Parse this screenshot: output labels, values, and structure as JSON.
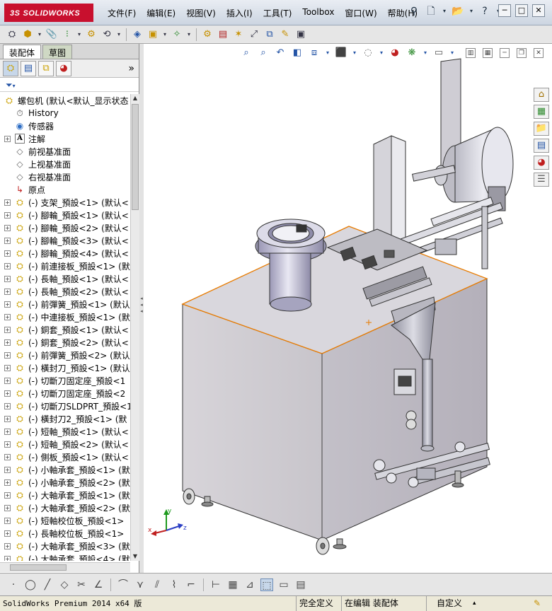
{
  "app": {
    "logo": "SOLIDWORKS",
    "logo_prefix": "3S"
  },
  "menu": [
    "文件(F)",
    "编辑(E)",
    "视图(V)",
    "插入(I)",
    "工具(T)",
    "Toolbox",
    "窗口(W)",
    "帮助(H)"
  ],
  "quick_access": {
    "pin_icon": "pin-icon",
    "new_icon": "new-document-icon",
    "open_icon": "open-folder-icon",
    "help": "?"
  },
  "window_controls": [
    "─",
    "□",
    "✕"
  ],
  "left_panel": {
    "tabs": [
      "装配体",
      "草图"
    ],
    "more": "»",
    "filter_icon": "filter-icon",
    "tree": {
      "root": "螺包机  (默认<默认_显示状态",
      "items": [
        {
          "label": "History",
          "icon": "history-icon",
          "expandable": false
        },
        {
          "label": "传感器",
          "icon": "sensor-icon",
          "expandable": false
        },
        {
          "label": "注解",
          "icon": "annotation-icon",
          "expandable": true
        },
        {
          "label": "前视基准面",
          "icon": "plane-icon",
          "expandable": false
        },
        {
          "label": "上视基准面",
          "icon": "plane-icon",
          "expandable": false
        },
        {
          "label": "右视基准面",
          "icon": "plane-icon",
          "expandable": false
        },
        {
          "label": "原点",
          "icon": "origin-icon",
          "expandable": false
        },
        {
          "label": "(-) 支架_預設<1> (默认<",
          "icon": "part-icon",
          "expandable": true
        },
        {
          "label": "(-) 腳輪_預設<1> (默认<",
          "icon": "part-icon",
          "expandable": true
        },
        {
          "label": "(-) 腳輪_預設<2> (默认<",
          "icon": "part-icon",
          "expandable": true
        },
        {
          "label": "(-) 腳輪_預設<3> (默认<",
          "icon": "part-icon",
          "expandable": true
        },
        {
          "label": "(-) 腳輪_預設<4> (默认<",
          "icon": "part-icon",
          "expandable": true
        },
        {
          "label": "(-) 前連接板_預設<1> (默",
          "icon": "part-icon",
          "expandable": true
        },
        {
          "label": "(-) 長軸_預設<1> (默认<",
          "icon": "part-icon",
          "expandable": true
        },
        {
          "label": "(-) 長軸_預設<2> (默认<",
          "icon": "part-icon",
          "expandable": true
        },
        {
          "label": "(-) 前彈簧_預設<1> (默认",
          "icon": "part-icon",
          "expandable": true
        },
        {
          "label": "(-) 中連接板_預設<1> (默",
          "icon": "part-icon",
          "expandable": true
        },
        {
          "label": "(-) 銅套_預設<1> (默认<",
          "icon": "part-icon",
          "expandable": true
        },
        {
          "label": "(-) 銅套_預設<2> (默认<",
          "icon": "part-icon",
          "expandable": true
        },
        {
          "label": "(-) 前彈簧_預設<2> (默认",
          "icon": "part-icon",
          "expandable": true
        },
        {
          "label": "(-) 橫封刀_預設<1> (默认",
          "icon": "part-icon",
          "expandable": true
        },
        {
          "label": "(-) 切斷刀固定座_預設<1",
          "icon": "part-icon",
          "expandable": true
        },
        {
          "label": "(-) 切斷刀固定座_預設<2",
          "icon": "part-icon",
          "expandable": true
        },
        {
          "label": "(-) 切斷刀SLDPRT_預設<1",
          "icon": "part-icon",
          "expandable": true
        },
        {
          "label": "(-) 橫封刀2_預設<1> (默",
          "icon": "part-icon",
          "expandable": true
        },
        {
          "label": "(-) 短軸_預設<1> (默认<",
          "icon": "part-icon",
          "expandable": true
        },
        {
          "label": "(-) 短軸_預設<2> (默认<",
          "icon": "part-icon",
          "expandable": true
        },
        {
          "label": "(-) 側板_預設<1> (默认<",
          "icon": "part-icon",
          "expandable": true
        },
        {
          "label": "(-) 小軸承套_預設<1> (默",
          "icon": "part-icon",
          "expandable": true
        },
        {
          "label": "(-) 小軸承套_預設<2> (默",
          "icon": "part-icon",
          "expandable": true
        },
        {
          "label": "(-) 大軸承套_預設<1> (默",
          "icon": "part-icon",
          "expandable": true
        },
        {
          "label": "(-) 大軸承套_預設<2> (默",
          "icon": "part-icon",
          "expandable": true
        },
        {
          "label": "(-) 短軸校位板_預設<1>",
          "icon": "part-icon",
          "expandable": true
        },
        {
          "label": "(-) 長軸校位板_預設<1>",
          "icon": "part-icon",
          "expandable": true
        },
        {
          "label": "(-) 大軸承套_預設<3> (默",
          "icon": "part-icon",
          "expandable": true
        },
        {
          "label": "(-) 大軸承套_預設<4> (默",
          "icon": "part-icon",
          "expandable": true
        }
      ]
    }
  },
  "triad": {
    "x": "x",
    "y": "y",
    "z": "z"
  },
  "status": {
    "app_version": "SolidWorks Premium 2014 x64 版",
    "definition": "完全定义",
    "editing": "在编辑 装配体",
    "units": "自定义",
    "help_icon": "question-mark-icon"
  },
  "colors": {
    "accent_red": "#c8102e",
    "machine_body": "#c9c5cc",
    "selection_orange": "#e87b00"
  }
}
